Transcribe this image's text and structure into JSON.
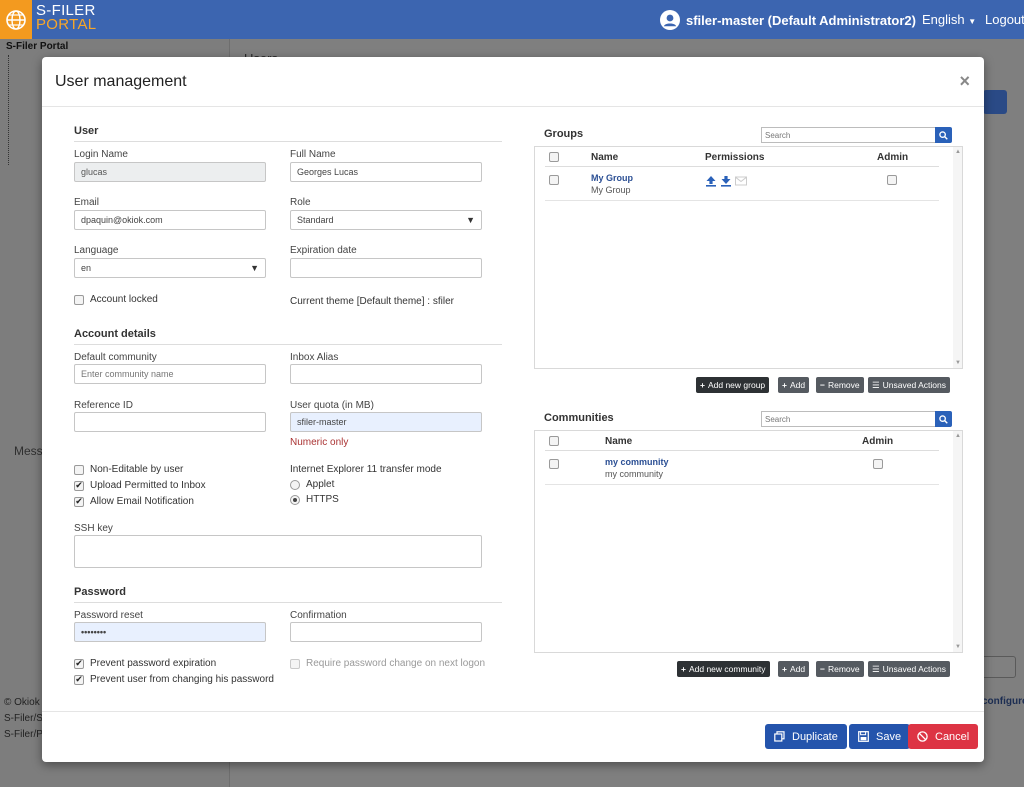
{
  "app": {
    "logo_line1": "S-FILER",
    "logo_line2": "PORTAL",
    "user_display": "sfiler-master (Default Administrator2)",
    "language_menu": "English",
    "logout": "Logout"
  },
  "background": {
    "sidebar_title": "S-Filer Portal",
    "page_title": "Users",
    "messages_label": "Mess",
    "footer_lines": [
      "© Okiok",
      "S-Filer/Sa",
      "S-Filer/Po"
    ],
    "configure_link": "configure"
  },
  "modal": {
    "title": "User management",
    "close": "×",
    "user_section": {
      "heading": "User",
      "login_name_label": "Login Name",
      "login_name_value": "glucas",
      "full_name_label": "Full Name",
      "full_name_value": "Georges Lucas",
      "email_label": "Email",
      "email_value": "dpaquin@okiok.com",
      "role_label": "Role",
      "role_value": "Standard",
      "language_label": "Language",
      "language_value": "en",
      "expiration_label": "Expiration date",
      "expiration_value": "",
      "account_locked_label": "Account locked",
      "account_locked": false,
      "current_theme_text": "Current theme [Default theme] : sfiler"
    },
    "account_section": {
      "heading": "Account details",
      "default_community_label": "Default community",
      "default_community_placeholder": "Enter community name",
      "inbox_alias_label": "Inbox Alias",
      "inbox_alias_value": "",
      "reference_id_label": "Reference ID",
      "reference_id_value": "",
      "user_quota_label": "User quota (in MB)",
      "user_quota_value": "sfiler-master",
      "numeric_hint": "Numeric only",
      "checkboxes": [
        {
          "label": "Non-Editable by user",
          "checked": false
        },
        {
          "label": "Upload Permitted to Inbox",
          "checked": true
        },
        {
          "label": "Allow Email Notification",
          "checked": true
        }
      ],
      "ie_mode_label": "Internet Explorer 11 transfer mode",
      "ie_modes": [
        {
          "label": "Applet",
          "selected": false
        },
        {
          "label": "HTTPS",
          "selected": true
        }
      ],
      "ssh_key_label": "SSH key",
      "ssh_key_value": ""
    },
    "password_section": {
      "heading": "Password",
      "reset_label": "Password reset",
      "reset_value": "••••••••",
      "confirmation_label": "Confirmation",
      "confirmation_value": "",
      "options": [
        {
          "label": "Prevent password expiration",
          "checked": true
        },
        {
          "label": "Prevent user from changing his password",
          "checked": true
        }
      ],
      "require_change_label": "Require password change on next logon",
      "require_change_checked": false
    },
    "groups": {
      "title": "Groups",
      "search_placeholder": "Search",
      "columns": [
        "Name",
        "Permissions",
        "Admin"
      ],
      "rows": [
        {
          "name": "My Group",
          "description": "My Group",
          "admin": false
        }
      ],
      "permission_icons": [
        "upload-icon",
        "download-icon",
        "mail-icon"
      ],
      "actions": {
        "add_new": "Add new group",
        "add": "Add",
        "remove": "Remove",
        "unsaved": "Unsaved Actions"
      }
    },
    "communities": {
      "title": "Communities",
      "search_placeholder": "Search",
      "columns": [
        "Name",
        "Admin"
      ],
      "rows": [
        {
          "name": "my community",
          "description": "my community",
          "admin": false
        }
      ],
      "actions": {
        "add_new": "Add new community",
        "add": "Add",
        "remove": "Remove",
        "unsaved": "Unsaved Actions"
      }
    },
    "footer": {
      "duplicate": "Duplicate",
      "save": "Save",
      "cancel": "Cancel"
    }
  },
  "colors": {
    "topbar": "#3c65b0",
    "logo": "#f39a1f",
    "primary_button": "#2454ac",
    "danger_button": "#dd3444",
    "link": "#2b4f94"
  }
}
